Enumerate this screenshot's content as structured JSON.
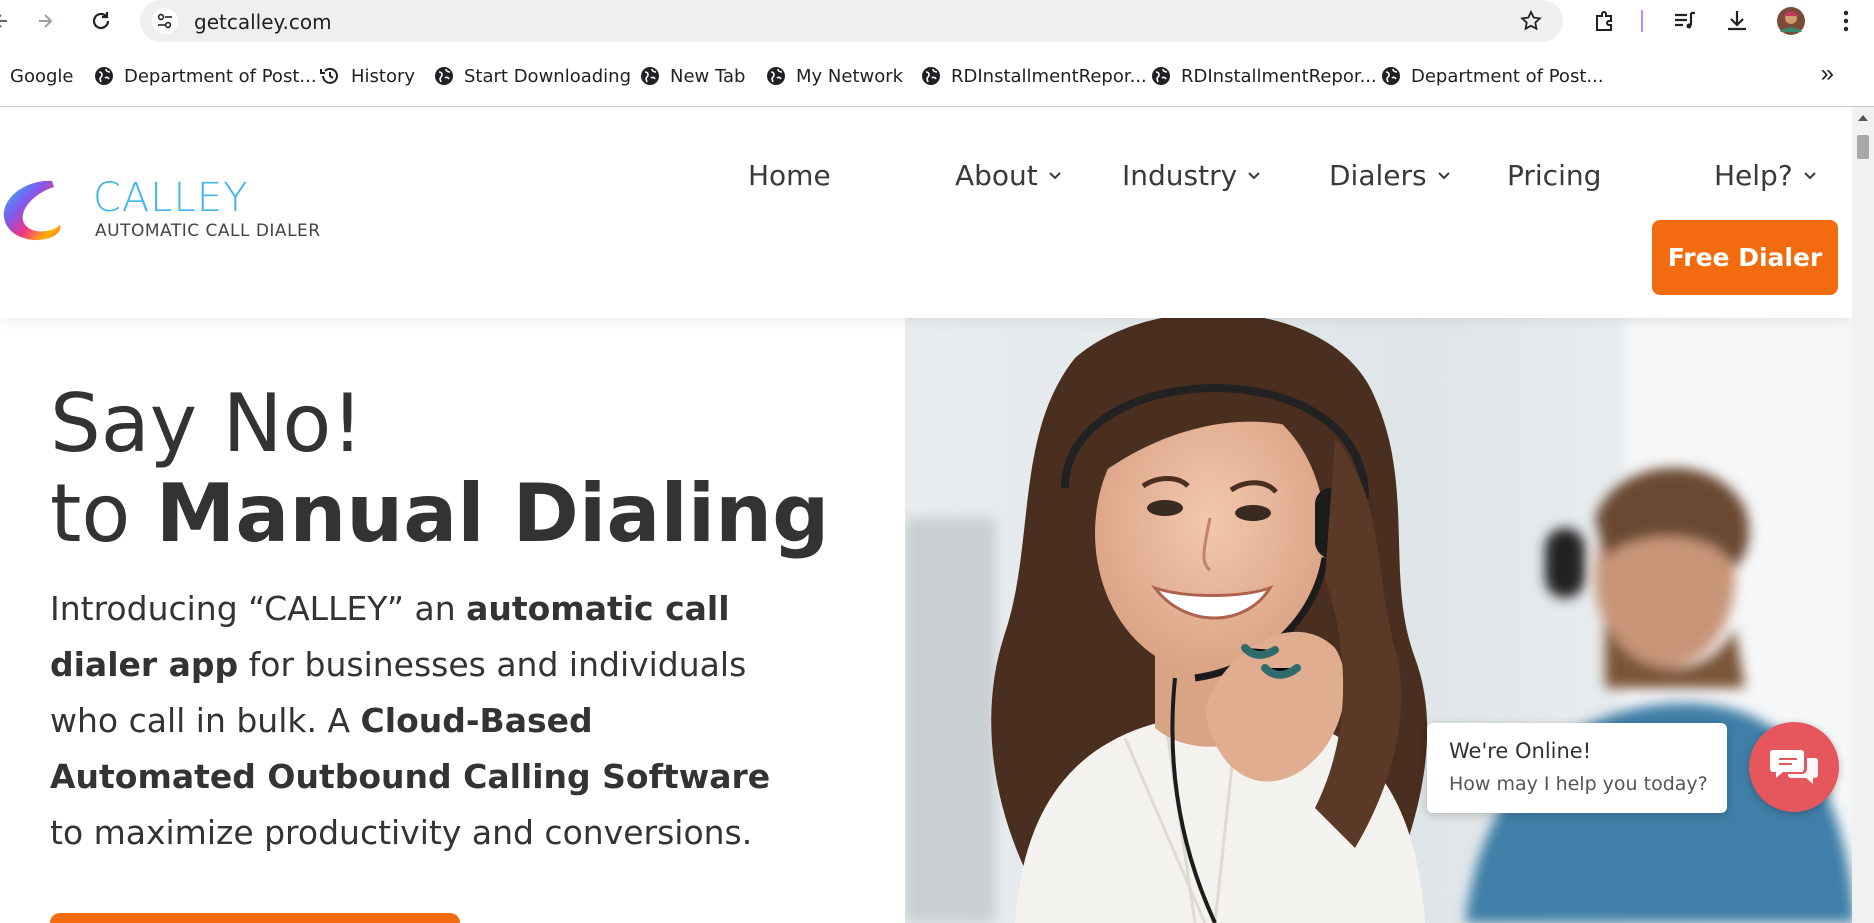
{
  "browser": {
    "url": "getcalley.com",
    "bookmarks": [
      {
        "label": "Google",
        "icon": "none"
      },
      {
        "label": "Department of Post...",
        "icon": "globe-icon"
      },
      {
        "label": "History",
        "icon": "history-icon"
      },
      {
        "label": "Start Downloading",
        "icon": "globe-icon"
      },
      {
        "label": "New Tab",
        "icon": "globe-icon"
      },
      {
        "label": "My Network",
        "icon": "globe-icon"
      },
      {
        "label": "RDInstallmentRepor...",
        "icon": "globe-icon"
      },
      {
        "label": "RDInstallmentRepor...",
        "icon": "globe-icon"
      },
      {
        "label": "Department of Post...",
        "icon": "globe-icon"
      }
    ],
    "more_bookmarks": "»"
  },
  "site": {
    "logo": {
      "name": "CALLEY",
      "tagline": "AUTOMATIC CALL DIALER"
    },
    "nav": [
      {
        "label": "Home",
        "has_dropdown": false
      },
      {
        "label": "About",
        "has_dropdown": true
      },
      {
        "label": "Industry",
        "has_dropdown": true
      },
      {
        "label": "Dialers",
        "has_dropdown": true
      },
      {
        "label": "Pricing",
        "has_dropdown": false
      },
      {
        "label": "Help?",
        "has_dropdown": true
      }
    ],
    "cta": "Free Dialer"
  },
  "hero": {
    "line1": "Say No!",
    "line2_prefix": "to ",
    "line2_bold": "Manual Dialing",
    "para": {
      "p1": "Introducing “CALLEY” an ",
      "b1": "automatic call dialer app",
      "p2": " for businesses and individuals who call in bulk. A ",
      "b2": "Cloud-Based Automated Outbound Calling Software",
      "p3": " to maximize productivity and conversions."
    }
  },
  "chat": {
    "title": "We're Online!",
    "subtitle": "How may I help you today?"
  },
  "colors": {
    "brand_orange": "#f26b0f",
    "logo_blue": "#3fb6e8",
    "chat_red": "#e5575d"
  }
}
